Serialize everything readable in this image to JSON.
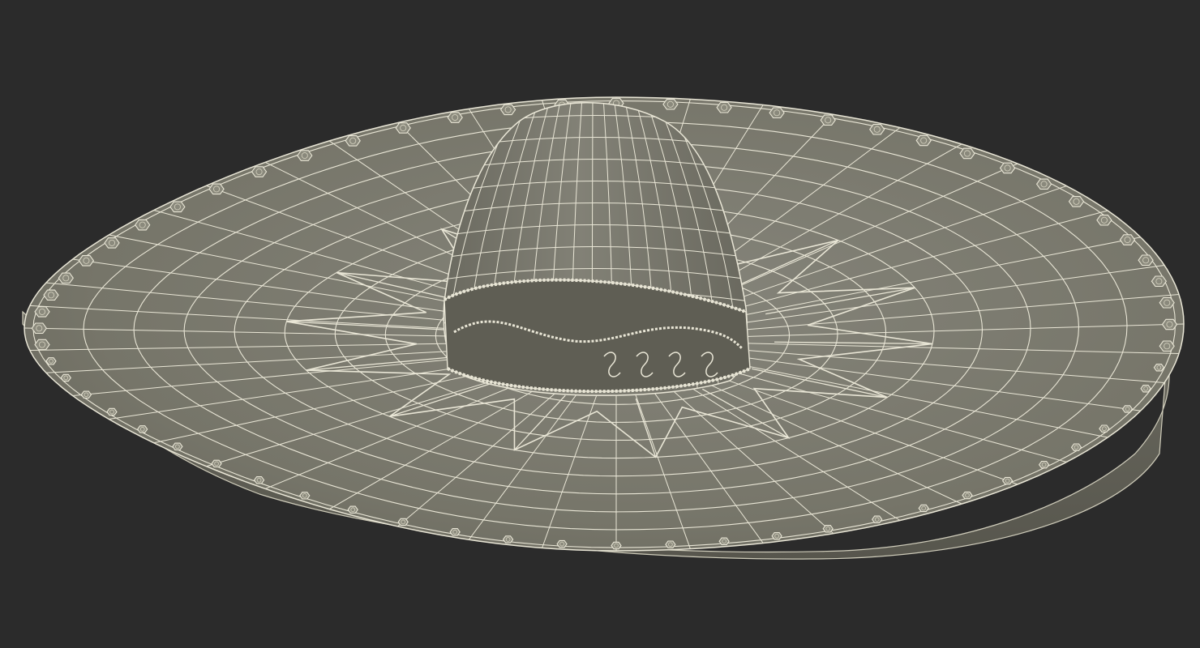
{
  "scene": {
    "subject": "sombrero-wireframe-render",
    "colors": {
      "background": "#2b2b2b",
      "surface": "#757467",
      "surface_light": "#8a897c",
      "surface_dark": "#5f5e54",
      "wire": "#e9e6d6",
      "wire_soft": "#cfccba"
    },
    "views": {
      "viewport": "perspective-wireframe"
    }
  }
}
